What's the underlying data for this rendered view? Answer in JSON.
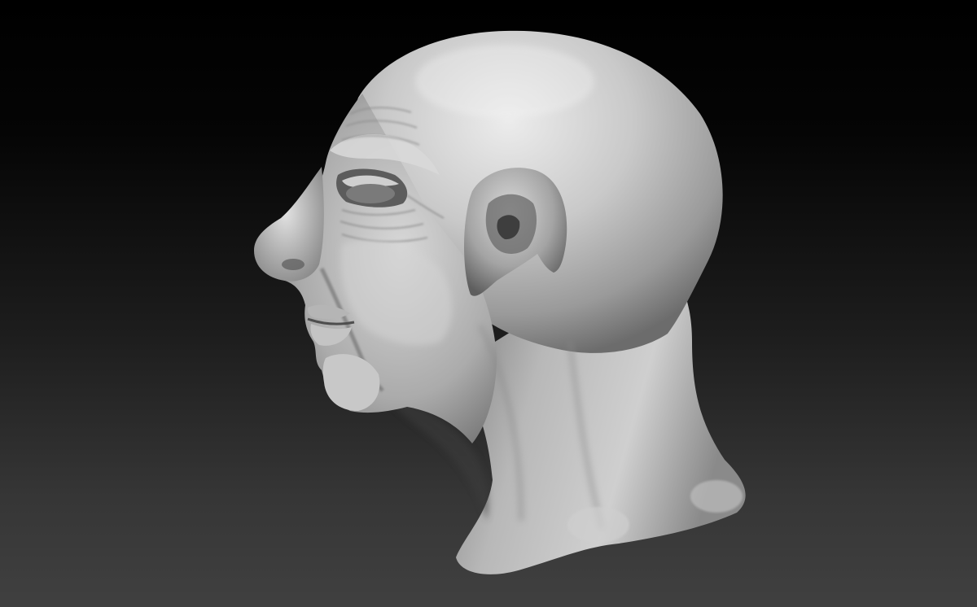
{
  "viewport": {
    "background_top": "#000000",
    "background_bottom": "#404040"
  },
  "sculpt": {
    "subject": "bald-elderly-head-profile",
    "facing": "left",
    "material_color": "#bdbdbd",
    "highlight_color": "#e8e8e8",
    "shadow_color": "#4a4a4a"
  }
}
